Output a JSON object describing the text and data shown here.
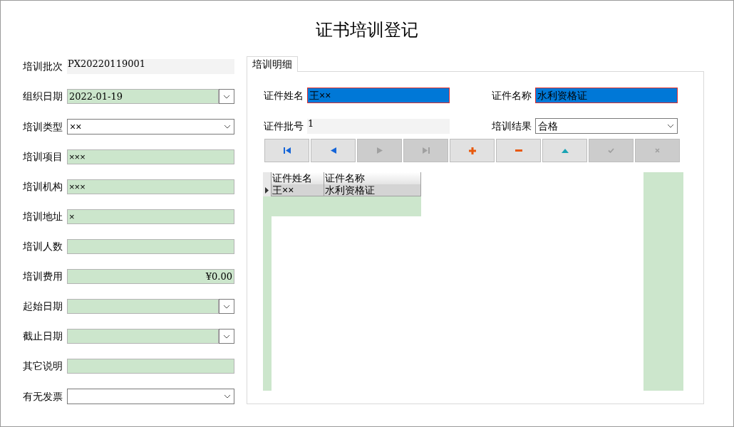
{
  "title": "证书培训登记",
  "fields": [
    {
      "label": "培训批次",
      "kind": "readonly",
      "value": "PX20220119001"
    },
    {
      "label": "组织日期",
      "kind": "date",
      "value": "2022-01-19"
    },
    {
      "label": "培训类型",
      "kind": "combo",
      "value": "××"
    },
    {
      "label": "培训项目",
      "kind": "text",
      "value": "×××"
    },
    {
      "label": "培训机构",
      "kind": "text",
      "value": "×××"
    },
    {
      "label": "培训地址",
      "kind": "text",
      "value": "×"
    },
    {
      "label": "培训人数",
      "kind": "text"
    },
    {
      "label": "培训费用",
      "kind": "currency",
      "value": "¥0.00"
    },
    {
      "label": "起始日期",
      "kind": "date"
    },
    {
      "label": "截止日期",
      "kind": "date"
    },
    {
      "label": "其它说明",
      "kind": "text"
    },
    {
      "label": "有无发票",
      "kind": "combo"
    }
  ],
  "tabs": [
    {
      "label": "培训明细",
      "selected": true
    }
  ],
  "detail_fields": [
    {
      "label": "证件姓名",
      "kind": "highlighted",
      "value": "王××"
    },
    {
      "label": "证件名称",
      "kind": "highlighted",
      "value": "水利资格证"
    },
    {
      "label": "证件批号",
      "kind": "readonly",
      "value": "1"
    },
    {
      "label": "培训结果",
      "kind": "combo",
      "value": "合格"
    }
  ],
  "nav_buttons": [
    {
      "kind": "first",
      "disabled": false
    },
    {
      "kind": "prev",
      "disabled": false
    },
    {
      "kind": "next",
      "disabled": true
    },
    {
      "kind": "last",
      "disabled": true
    },
    {
      "kind": "add",
      "disabled": false
    },
    {
      "kind": "delete",
      "disabled": false
    },
    {
      "kind": "up",
      "disabled": false
    },
    {
      "kind": "save",
      "disabled": true
    },
    {
      "kind": "cancel",
      "disabled": true
    }
  ],
  "grid": {
    "columns": [
      "证件姓名",
      "证件名称"
    ],
    "rows": [
      {
        "cells": [
          "王××",
          "水利资格证"
        ],
        "selected": true
      }
    ]
  }
}
